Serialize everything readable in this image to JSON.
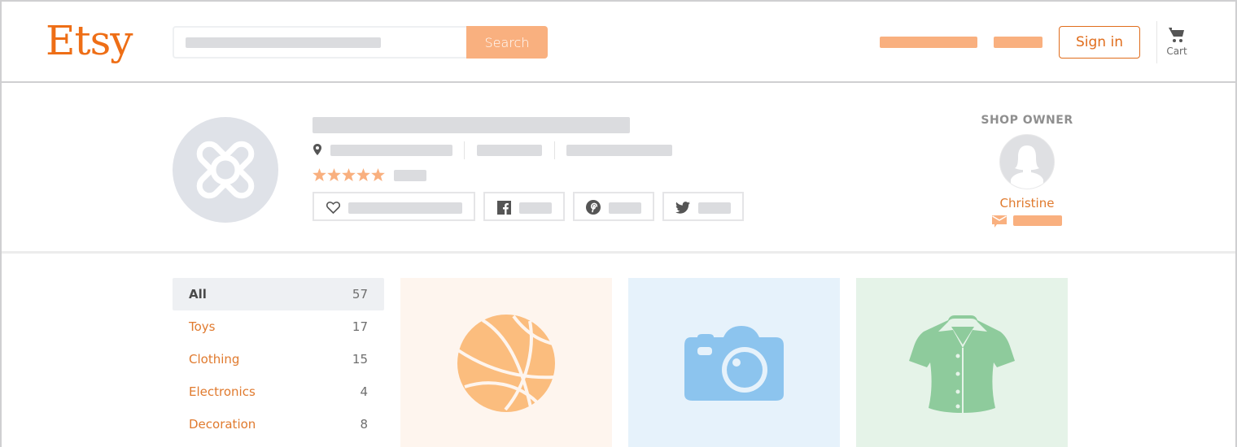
{
  "header": {
    "logo": "Etsy",
    "search": {
      "placeholder": "",
      "button_label": "Search"
    },
    "nav_placeholders": [
      "",
      ""
    ],
    "signin_label": "Sign in",
    "cart_label": "Cart",
    "cart_icon": "cart-icon"
  },
  "shop": {
    "avatar_icon": "bandage-icon",
    "name": "",
    "location_icon": "map-pin-icon",
    "rating_stars": 5,
    "rating_max": 5,
    "actions": [
      {
        "id": "favorite",
        "icon": "heart-icon",
        "label": ""
      },
      {
        "id": "facebook",
        "icon": "facebook-icon",
        "label": ""
      },
      {
        "id": "pinterest",
        "icon": "pinterest-icon",
        "label": ""
      },
      {
        "id": "twitter",
        "icon": "twitter-icon",
        "label": ""
      }
    ]
  },
  "owner": {
    "heading": "SHOP OWNER",
    "name": "Christine",
    "contact_icon": "message-icon",
    "contact_label": ""
  },
  "categories": [
    {
      "name": "All",
      "count": "57",
      "active": true
    },
    {
      "name": "Toys",
      "count": "17",
      "active": false
    },
    {
      "name": "Clothing",
      "count": "15",
      "active": false
    },
    {
      "name": "Electronics",
      "count": "4",
      "active": false
    },
    {
      "name": "Decoration",
      "count": "8",
      "active": false
    }
  ],
  "listings": [
    {
      "icon": "basketball-icon",
      "bg": "#fef5ee",
      "color": "#fbbd7e"
    },
    {
      "icon": "camera-icon",
      "bg": "#e6f2fb",
      "color": "#8cc4ee"
    },
    {
      "icon": "shirt-icon",
      "bg": "#e5f3e8",
      "color": "#8ecb9c"
    }
  ],
  "colors": {
    "brand": "#ee6e16",
    "accent_light": "#f9b07f",
    "link": "#e07a2e",
    "placeholder": "#dbdcdf"
  }
}
